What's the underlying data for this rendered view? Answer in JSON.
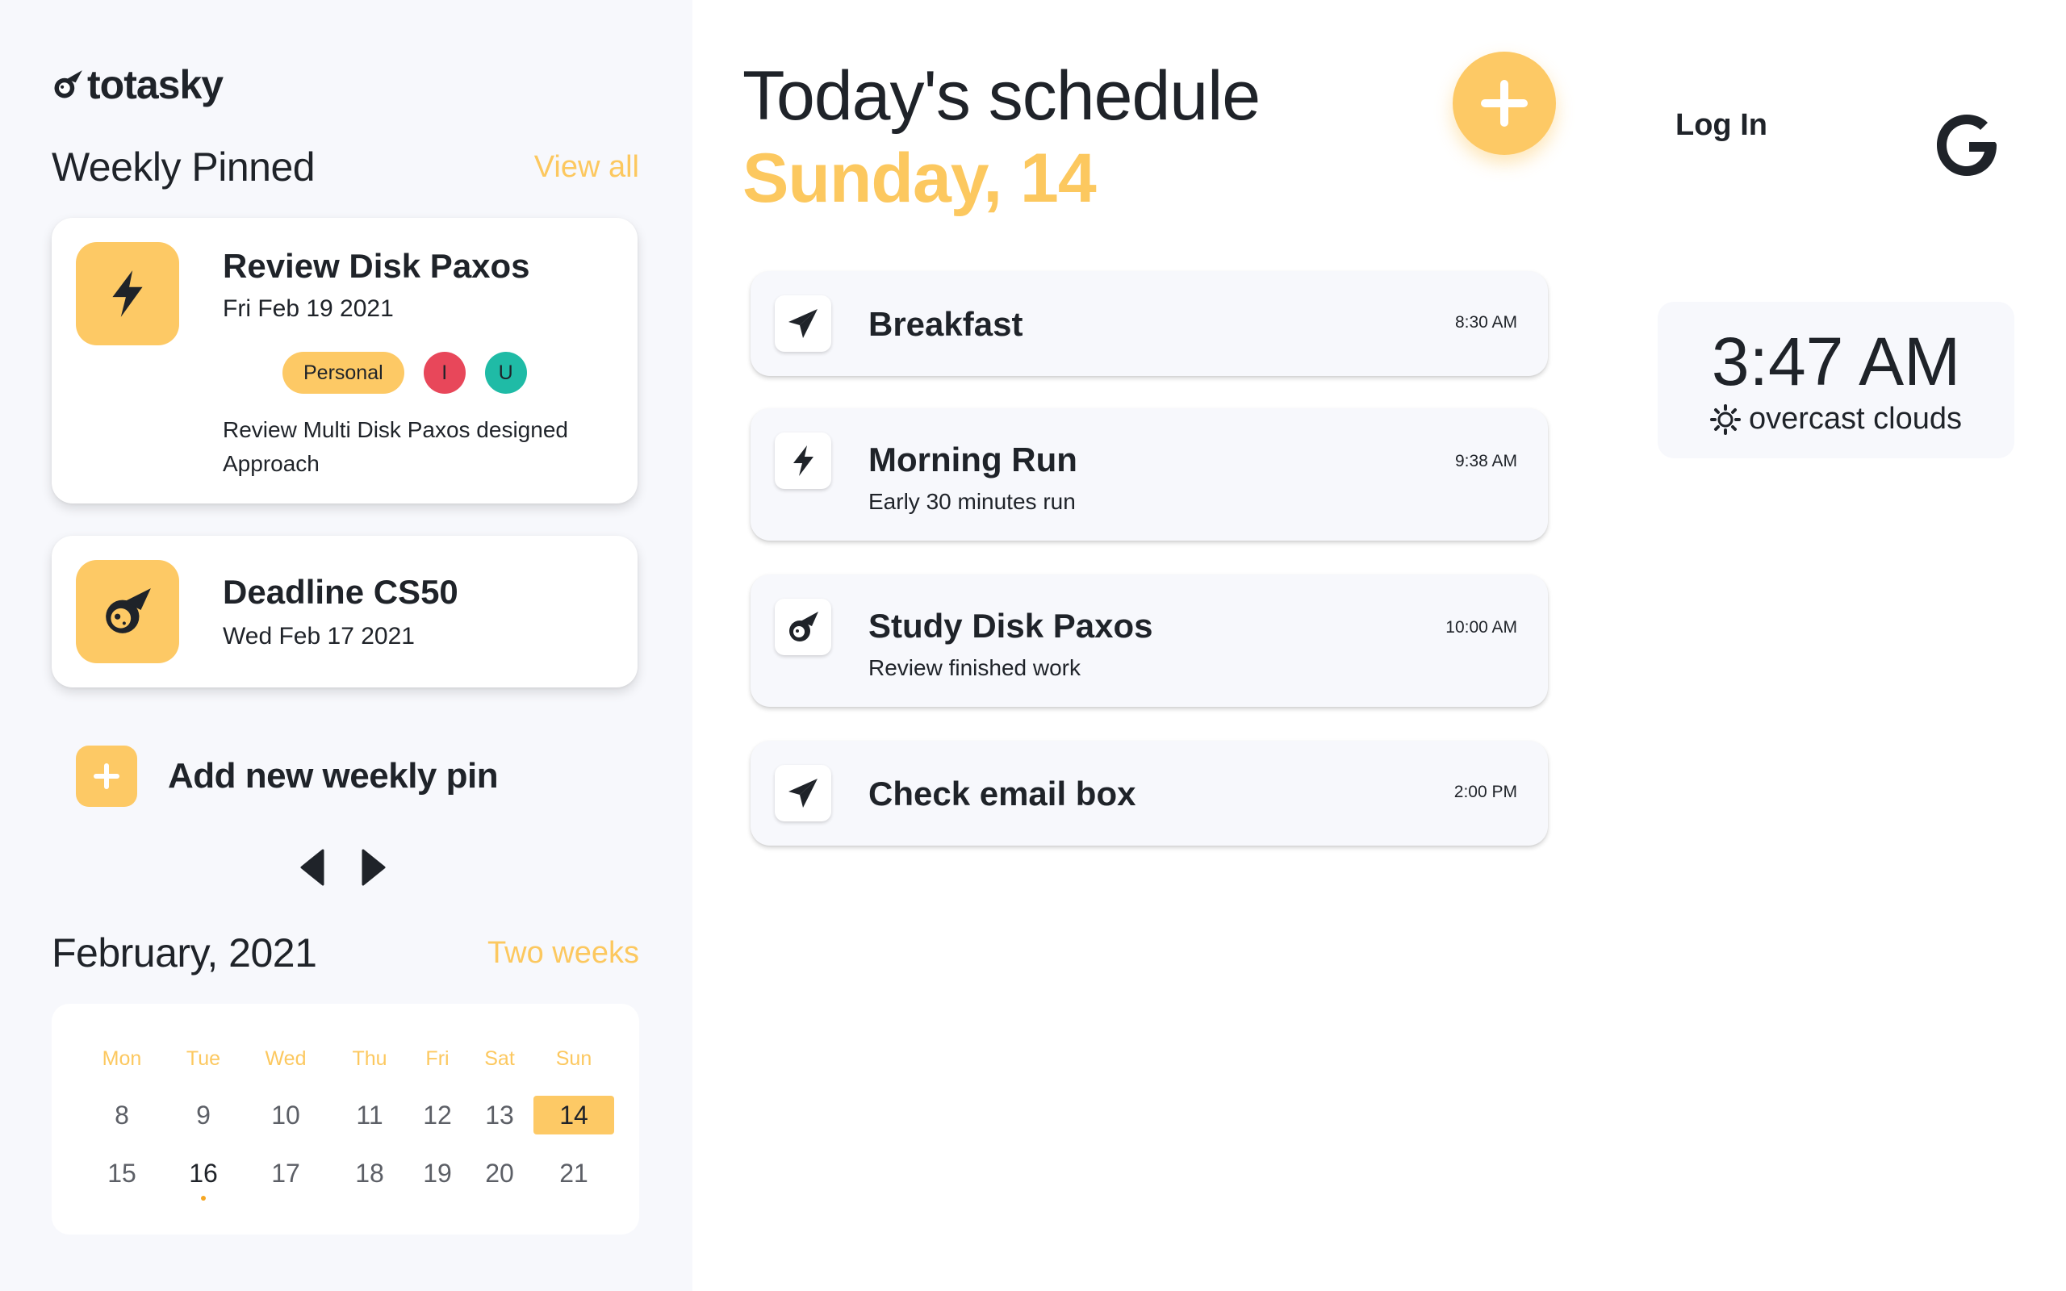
{
  "app": {
    "name": "totasky"
  },
  "weekly": {
    "title": "Weekly Pinned",
    "view_all": "View all",
    "pins": [
      {
        "title": "Review Disk Paxos",
        "date": "Fri Feb 19 2021",
        "icon": "bolt-icon",
        "tag": "Personal",
        "members": [
          "I",
          "U"
        ],
        "description": "Review Multi Disk Paxos designed Approach"
      },
      {
        "title": "Deadline CS50",
        "date": "Wed Feb 17 2021",
        "icon": "comet-icon"
      }
    ],
    "add_label": "Add new weekly pin"
  },
  "calendar": {
    "title": "February, 2021",
    "range_link": "Two weeks",
    "days_of_week": [
      "Mon",
      "Tue",
      "Wed",
      "Thu",
      "Fri",
      "Sat",
      "Sun"
    ],
    "week1": [
      "8",
      "9",
      "10",
      "11",
      "12",
      "13",
      "14"
    ],
    "week2": [
      "15",
      "16",
      "17",
      "18",
      "19",
      "20",
      "21"
    ],
    "selected_day": "14",
    "current_day": "16"
  },
  "schedule": {
    "title": "Today's schedule",
    "date": "Sunday, 14",
    "events": [
      {
        "title": "Breakfast",
        "subtitle": "",
        "time": "8:30 AM",
        "icon": "paper-plane-icon"
      },
      {
        "title": "Morning Run",
        "subtitle": "Early 30 minutes run",
        "time": "9:38 AM",
        "icon": "bolt-icon"
      },
      {
        "title": "Study Disk Paxos",
        "subtitle": "Review finished work",
        "time": "10:00 AM",
        "icon": "comet-icon"
      },
      {
        "title": "Check email box",
        "subtitle": "",
        "time": "2:00 PM",
        "icon": "paper-plane-icon"
      }
    ]
  },
  "auth": {
    "login_label": "Log In",
    "provider_icon": "google-icon"
  },
  "weather": {
    "time": "3:47 AM",
    "condition": "overcast clouds",
    "icon": "sun-icon"
  },
  "colors": {
    "accent": "#fdc965",
    "accent_text": "#fcc85f",
    "sidebar_bg": "#f7f8fc",
    "tag_red": "#e8475a",
    "tag_teal": "#1fbba6"
  }
}
